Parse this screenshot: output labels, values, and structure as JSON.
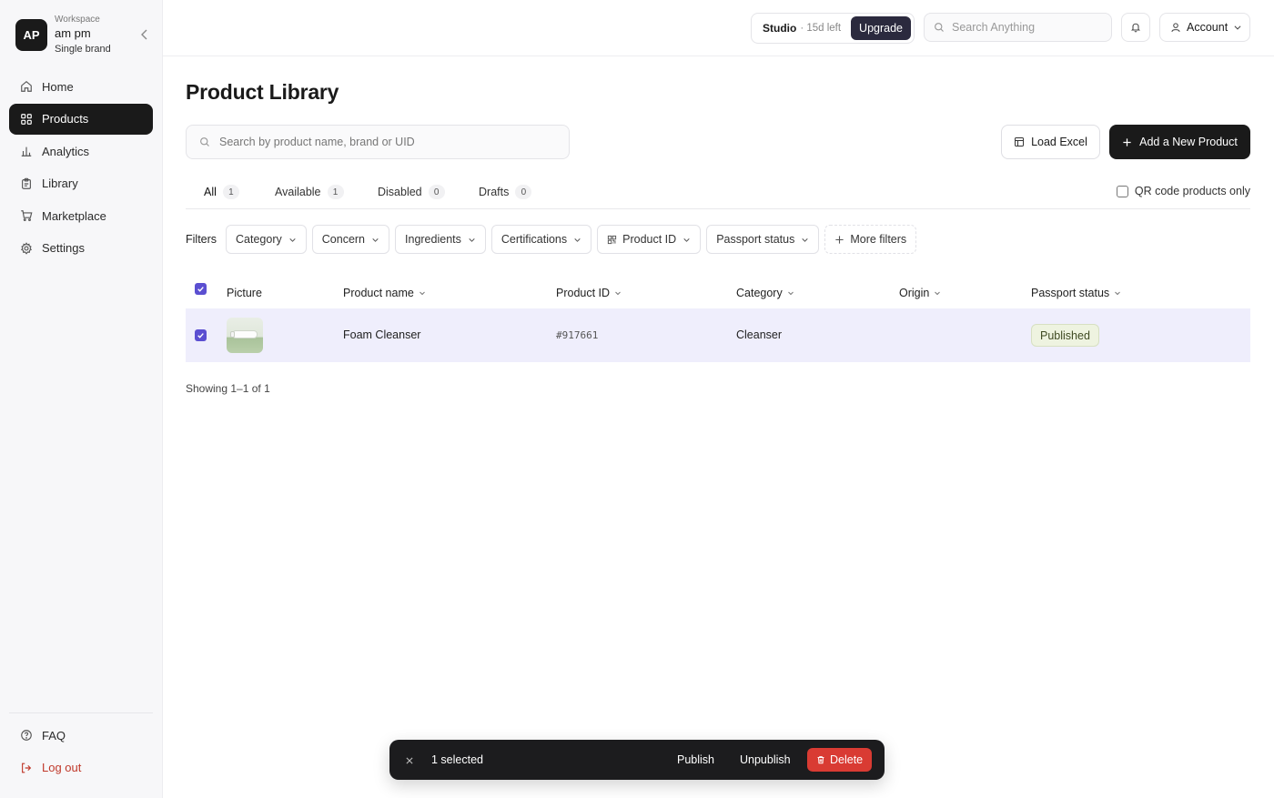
{
  "workspace": {
    "initials": "AP",
    "label": "Workspace",
    "name": "am pm",
    "brand_type": "Single brand"
  },
  "sidebar": {
    "items": [
      {
        "label": "Home",
        "icon": "home-icon"
      },
      {
        "label": "Products",
        "icon": "grid-icon",
        "active": true
      },
      {
        "label": "Analytics",
        "icon": "bar-chart-icon"
      },
      {
        "label": "Library",
        "icon": "clipboard-icon"
      },
      {
        "label": "Marketplace",
        "icon": "cart-icon"
      },
      {
        "label": "Settings",
        "icon": "gear-icon"
      }
    ],
    "bottom": [
      {
        "label": "FAQ",
        "icon": "help-circle-icon"
      },
      {
        "label": "Log out",
        "icon": "logout-icon"
      }
    ]
  },
  "topbar": {
    "plan": "Studio",
    "trial_left": "· 15d left",
    "upgrade_label": "Upgrade",
    "search_placeholder": "Search Anything",
    "account_label": "Account"
  },
  "page": {
    "title": "Product Library",
    "search_placeholder": "Search by product name, brand or UID",
    "load_excel_label": "Load Excel",
    "add_product_label": "Add a New Product"
  },
  "tabs": [
    {
      "label": "All",
      "count": "1",
      "active": true
    },
    {
      "label": "Available",
      "count": "1"
    },
    {
      "label": "Disabled",
      "count": "0"
    },
    {
      "label": "Drafts",
      "count": "0"
    }
  ],
  "qr_only_label": "QR code products only",
  "filters": {
    "label": "Filters",
    "chips": [
      "Category",
      "Concern",
      "Ingredients",
      "Certifications",
      "Product ID",
      "Passport status"
    ],
    "more_label": "More filters"
  },
  "table": {
    "headers": {
      "picture": "Picture",
      "product_name": "Product name",
      "product_id": "Product ID",
      "category": "Category",
      "origin": "Origin",
      "passport_status": "Passport status"
    },
    "rows": [
      {
        "product_name": "Foam Cleanser",
        "product_id": "#917661",
        "category": "Cleanser",
        "origin": "",
        "passport_status": "Published",
        "selected": true
      }
    ],
    "showing": "Showing 1–1 of 1"
  },
  "bulk_bar": {
    "selected_label": "1 selected",
    "publish_label": "Publish",
    "unpublish_label": "Unpublish",
    "delete_label": "Delete"
  },
  "colors": {
    "accent": "#5b4fd1",
    "danger": "#d93b33",
    "dark": "#1a1a1a",
    "selected_row": "#efeefc"
  }
}
